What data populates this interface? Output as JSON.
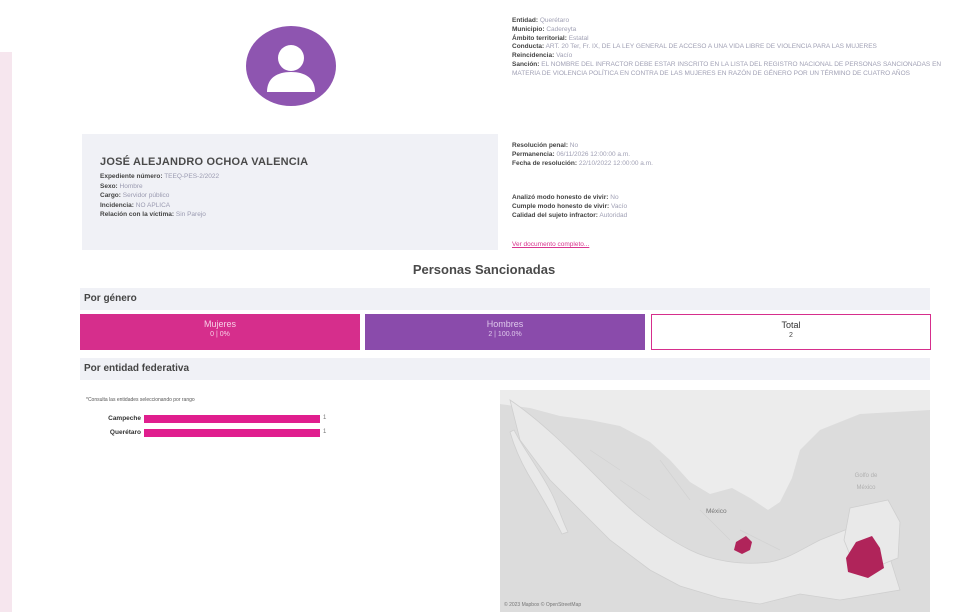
{
  "profile": {
    "name": "JOSÉ ALEJANDRO OCHOA VALENCIA",
    "fields": [
      {
        "label": "Expediente número:",
        "value": "TEEQ-PES-2/2022"
      },
      {
        "label": "Sexo:",
        "value": "Hombre"
      },
      {
        "label": "Cargo:",
        "value": "Servidor público"
      },
      {
        "label": "Incidencia:",
        "value": "NO APLICA"
      },
      {
        "label": "Relación con la víctima:",
        "value": "Sin Parejo"
      }
    ]
  },
  "details_top": [
    {
      "label": "Entidad:",
      "value": "Querétaro"
    },
    {
      "label": "Municipio:",
      "value": "Cadereyta"
    },
    {
      "label": "Ámbito territorial:",
      "value": "Estatal"
    },
    {
      "label": "Conducta:",
      "value": "ART. 20 Ter, Fr. IX, DE LA LEY GENERAL DE ACCESO A UNA VIDA LIBRE DE VIOLENCIA PARA LAS MUJERES"
    },
    {
      "label": "Reincidencia:",
      "value": "Vacío"
    },
    {
      "label": "Sanción:",
      "value": "EL NOMBRE DEL INFRACTOR DEBE ESTAR INSCRITO EN LA LISTA DEL REGISTRO NACIONAL DE PERSONAS SANCIONADAS EN MATERIA DE VIOLENCIA POLÍTICA EN CONTRA DE LAS MUJERES EN RAZÓN DE GÉNERO POR UN TÉRMINO DE CUATRO AÑOS"
    }
  ],
  "details_mid": [
    {
      "label": "Resolución penal:",
      "value": "No"
    },
    {
      "label": "Permanencia:",
      "value": "06/11/2026 12:00:00 a.m."
    },
    {
      "label": "Fecha de resolución:",
      "value": "22/10/2022 12:00:00 a.m."
    }
  ],
  "details_low": [
    {
      "label": "Analizó modo honesto de vivir:",
      "value": "No"
    },
    {
      "label": "Cumple modo honesto de vivir:",
      "value": "Vacío"
    },
    {
      "label": "Calidad del sujeto infractor:",
      "value": "Autoridad"
    }
  ],
  "doc_link": "Ver documento completo...",
  "section_title": "Personas Sancionadas",
  "by_gender": {
    "title": "Por género",
    "women": {
      "label": "Mujeres",
      "value": "0 | 0%"
    },
    "men": {
      "label": "Hombres",
      "value": "2 | 100.0%"
    },
    "total": {
      "label": "Total",
      "value": "2"
    }
  },
  "by_state": {
    "title": "Por entidad federativa",
    "hint": "*Consulta las entidades seleccionando por rango",
    "rows": [
      {
        "label": "Campeche",
        "value": 1,
        "display": "1"
      },
      {
        "label": "Querétaro",
        "value": 1,
        "display": "1"
      }
    ],
    "max": 1
  },
  "map": {
    "attribution": "© 2023 Mapbox © OpenStreetMap",
    "gulf_label": "Golfo de México",
    "country_label": "México",
    "highlight_color": "#b0245a"
  },
  "colors": {
    "women": "#d62e8c",
    "men": "#8a4bab",
    "bar": "#e01e8e"
  }
}
